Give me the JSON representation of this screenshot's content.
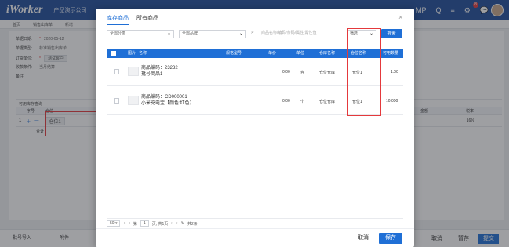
{
  "app": {
    "logo": "iWorker",
    "company": "产品演示公司"
  },
  "topnav": [
    "MP",
    "Q",
    "≡",
    "⚙",
    "💬"
  ],
  "notifications": "8",
  "subtabs": [
    "首页",
    "销售出库单",
    "新增"
  ],
  "form": {
    "date_label": "单据日期:",
    "date_value": "2020-05-12",
    "type_label": "单据类型:",
    "type_value": "标准销售出库单",
    "unit_label": "订货单位:",
    "unit_value": "测试客户",
    "cond_label": "收款条件:",
    "cond_value": "当月结算",
    "remark_label": "备注:"
  },
  "bg_table": {
    "section_title": "可用库存查询",
    "col_seq": "序号",
    "col_location": "仓位",
    "cell_location": "仓位1",
    "col_amount": "金额",
    "col_tax": "税率",
    "tax_value": "16%",
    "total": "合计"
  },
  "bottom": {
    "import_label": "批号导入",
    "attach_label": "附件",
    "cancel": "取消",
    "save_draft": "暂存",
    "submit": "提交"
  },
  "modal": {
    "tabs": [
      "库存商品",
      "所有商品"
    ],
    "category_placeholder": "全部分类",
    "brand_placeholder": "全部品牌",
    "search_placeholder": "商品名称/编码/条码/属性/属性值",
    "filter_label": "筛选",
    "search_button": "搜索",
    "columns": [
      "图片",
      "名称",
      "规格型号",
      "单价",
      "单位",
      "仓库名称",
      "仓位名称",
      "可用数量"
    ],
    "rows": [
      {
        "code_line": "商品编码：23232",
        "name_line": "批号商品1",
        "price": "0.00",
        "unit": "台",
        "warehouse": "仓位仓库",
        "location": "仓位1",
        "qty": "1.00"
      },
      {
        "code_line": "商品编码：CD000001",
        "name_line": "小米充电宝【颜色:红色】",
        "price": "0.00",
        "unit": "个",
        "warehouse": "仓位仓库",
        "location": "仓位1",
        "qty": "10.000"
      }
    ],
    "pager": {
      "page_size": "50",
      "page_prefix": "第",
      "page_value": "1",
      "page_suffix": "页, 共1页",
      "total": "共2条"
    },
    "cancel": "取消",
    "save": "保存"
  }
}
